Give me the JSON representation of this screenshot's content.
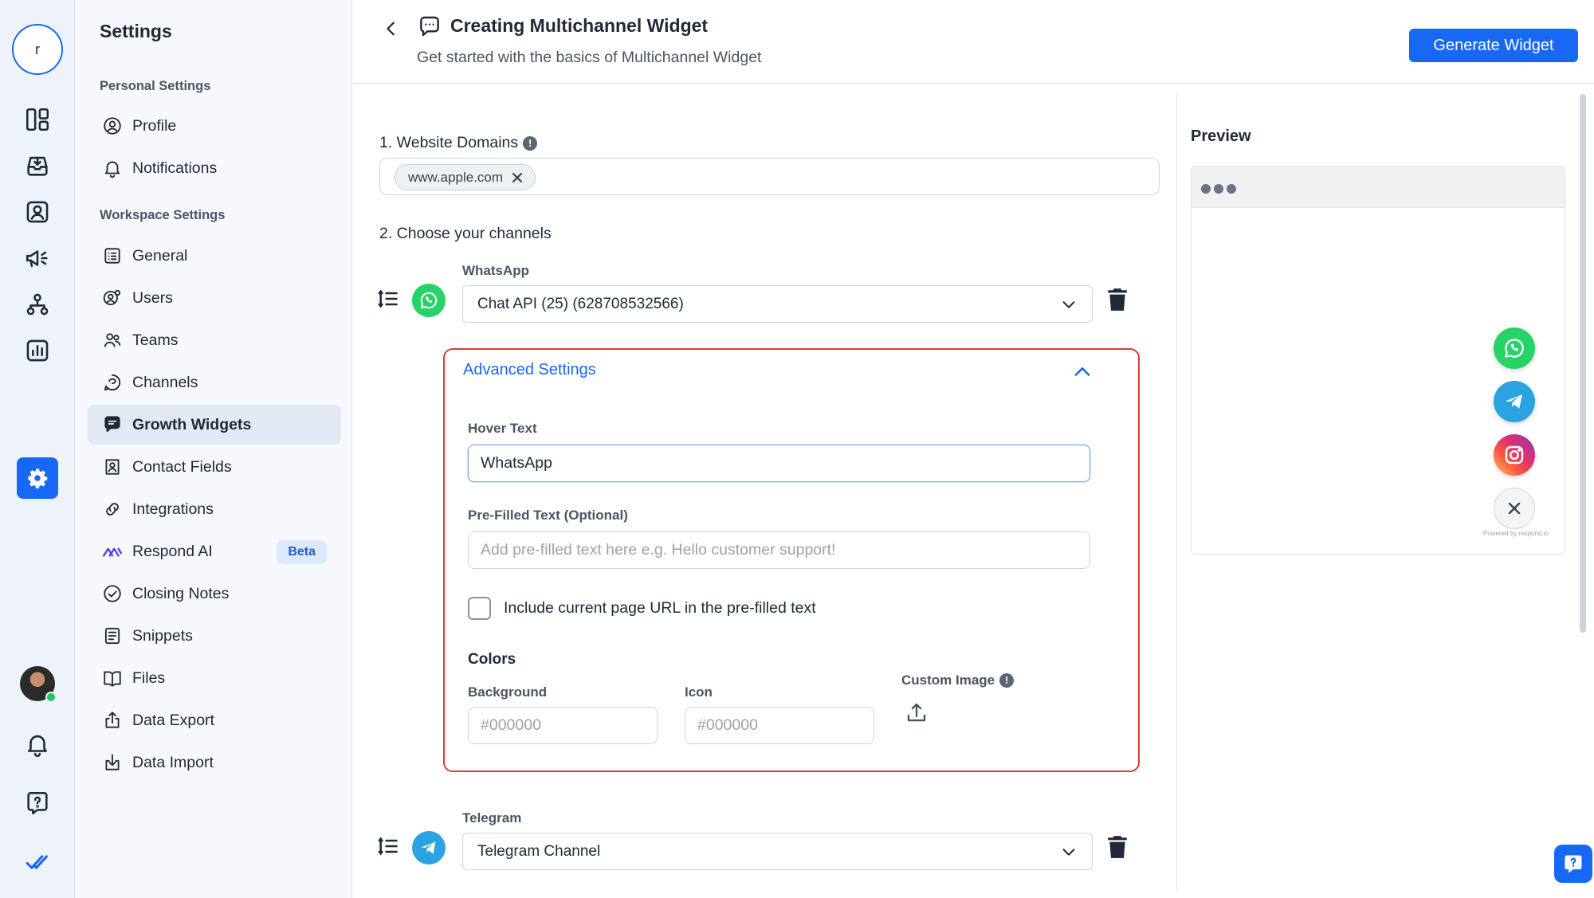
{
  "workspace": {
    "initial": "r"
  },
  "settings": {
    "title": "Settings",
    "personal_title": "Personal Settings",
    "workspace_title": "Workspace Settings",
    "personal_items": [
      {
        "label": "Profile",
        "icon": "profile-icon"
      },
      {
        "label": "Notifications",
        "icon": "bell-icon"
      }
    ],
    "workspace_items": [
      {
        "label": "General",
        "icon": "general-icon"
      },
      {
        "label": "Users",
        "icon": "users-icon"
      },
      {
        "label": "Teams",
        "icon": "teams-icon"
      },
      {
        "label": "Channels",
        "icon": "channels-icon"
      },
      {
        "label": "Growth Widgets",
        "icon": "growth-widgets-icon",
        "active": true
      },
      {
        "label": "Contact Fields",
        "icon": "contact-fields-icon"
      },
      {
        "label": "Integrations",
        "icon": "integrations-icon"
      },
      {
        "label": "Respond AI",
        "icon": "respond-ai-icon",
        "badge": "Beta"
      },
      {
        "label": "Closing Notes",
        "icon": "closing-notes-icon"
      },
      {
        "label": "Snippets",
        "icon": "snippets-icon"
      },
      {
        "label": "Files",
        "icon": "files-icon"
      },
      {
        "label": "Data Export",
        "icon": "data-export-icon"
      },
      {
        "label": "Data Import",
        "icon": "data-import-icon"
      }
    ]
  },
  "header": {
    "title": "Creating Multichannel Widget",
    "subtitle": "Get started with the basics of Multichannel Widget",
    "generate_label": "Generate Widget"
  },
  "form": {
    "domains_label": "1. Website Domains",
    "domain_chip": "www.apple.com",
    "channels_label": "2. Choose your channels",
    "whatsapp": {
      "label": "WhatsApp",
      "selected": "Chat API (25) (628708532566)"
    },
    "advanced": {
      "title": "Advanced Settings",
      "hover_label": "Hover Text",
      "hover_value": "WhatsApp",
      "prefilled_label": "Pre-Filled Text (Optional)",
      "prefilled_placeholder": "Add pre-filled text here e.g. Hello customer support!",
      "include_url_label": "Include current page URL in the pre-filled text",
      "include_url_checked": false,
      "colors_label": "Colors",
      "background_label": "Background",
      "background_placeholder": "#000000",
      "icon_label": "Icon",
      "icon_placeholder": "#000000",
      "custom_image_label": "Custom Image"
    },
    "telegram": {
      "label": "Telegram",
      "selected": "Telegram Channel"
    }
  },
  "preview": {
    "title": "Preview",
    "powered_by": "Powered by respond.io",
    "buttons": [
      "whatsapp-icon",
      "telegram-icon",
      "instagram-icon",
      "close-icon"
    ]
  },
  "colors": {
    "accent": "#1769f5",
    "whatsapp": "#25d366",
    "telegram": "#2aa3e0",
    "highlight_border": "#e53935"
  }
}
